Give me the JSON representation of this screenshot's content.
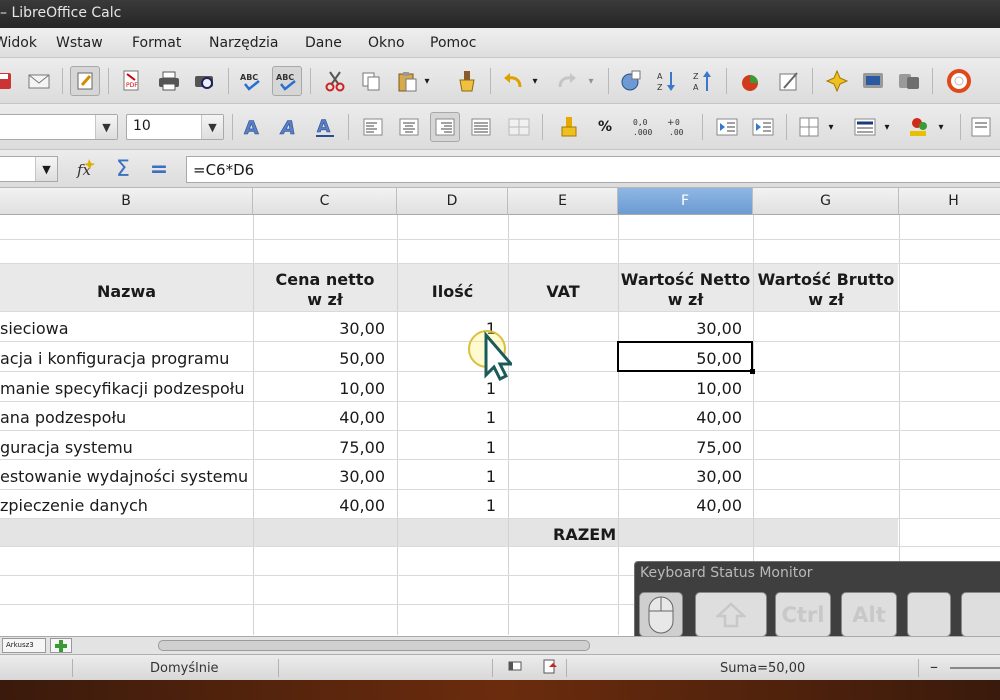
{
  "window": {
    "title": "– LibreOffice Calc"
  },
  "menu": [
    "Widok",
    "Wstaw",
    "Format",
    "Narzędzia",
    "Dane",
    "Okno",
    "Pomoc"
  ],
  "toolbar": {
    "font_size": "10",
    "font_name": ""
  },
  "formula_bar": {
    "cell_ref": "",
    "formula": "=C6*D6"
  },
  "columns": [
    "B",
    "C",
    "D",
    "E",
    "F",
    "G",
    "H"
  ],
  "active_column": "F",
  "table": {
    "headers": {
      "nazwa": "Nazwa",
      "cena_line1": "Cena netto",
      "cena_line2": "w zł",
      "ilosc": "Ilość",
      "vat": "VAT",
      "netto_line1": "Wartość Netto",
      "netto_line2": "w zł",
      "brutto_line1": "Wartość Brutto",
      "brutto_line2": "w zł"
    },
    "rows": [
      {
        "nazwa": "sieciowa",
        "cena": "30,00",
        "ilosc": "1",
        "vat": "",
        "netto": "30,00",
        "brutto": ""
      },
      {
        "nazwa": "acja i konfiguracja programu",
        "cena": "50,00",
        "ilosc": "",
        "vat": "",
        "netto": "50,00",
        "brutto": ""
      },
      {
        "nazwa": "manie specyfikacji podzespołu",
        "cena": "10,00",
        "ilosc": "1",
        "vat": "",
        "netto": "10,00",
        "brutto": ""
      },
      {
        "nazwa": "ana podzespołu",
        "cena": "40,00",
        "ilosc": "1",
        "vat": "",
        "netto": "40,00",
        "brutto": ""
      },
      {
        "nazwa": "guracja systemu",
        "cena": "75,00",
        "ilosc": "1",
        "vat": "",
        "netto": "75,00",
        "brutto": ""
      },
      {
        "nazwa": "estowanie wydajności systemu",
        "cena": "30,00",
        "ilosc": "1",
        "vat": "",
        "netto": "30,00",
        "brutto": ""
      },
      {
        "nazwa": "zpieczenie danych",
        "cena": "40,00",
        "ilosc": "1",
        "vat": "",
        "netto": "40,00",
        "brutto": ""
      }
    ],
    "razem_label": "RAZEM"
  },
  "keyboard_monitor": {
    "title": "Keyboard Status Monitor",
    "keys": [
      "",
      "Ctrl",
      "Alt",
      "",
      ""
    ]
  },
  "sheet_tab": "Arkusz3",
  "status": {
    "page_style": "Domyślnie",
    "sum": "Suma=50,00"
  }
}
